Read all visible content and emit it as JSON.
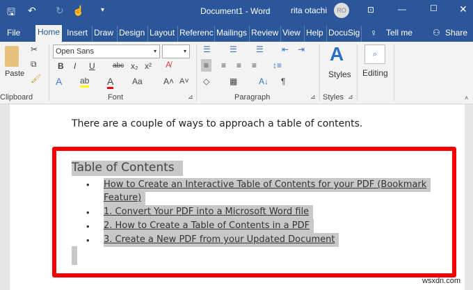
{
  "titlebar": {
    "title": "Document1  -  Word",
    "user": "rita otachi",
    "avatar": "RO"
  },
  "tabs": [
    "File",
    "Home",
    "Insert",
    "Draw",
    "Design",
    "Layout",
    "Referenc",
    "Mailings",
    "Review",
    "View",
    "Help",
    "DocuSig"
  ],
  "tell_me": "Tell me",
  "share": "Share",
  "ribbon": {
    "paste": "Paste",
    "font_name": "Open Sans",
    "font_size": "",
    "styles": "Styles",
    "editing": "Editing",
    "groups": {
      "clipboard": "Clipboard",
      "font": "Font",
      "paragraph": "Paragraph",
      "styles": "Styles"
    }
  },
  "document": {
    "intro": "There are a couple of ways to approach a table of contents.",
    "toc_title": "Table of Contents",
    "items": [
      "How to Create an Interactive Table of Contents for your PDF (Bookmark",
      "Feature)",
      "1. Convert Your PDF into a Microsoft Word file",
      "2. How to Create a Table of Contents in a PDF",
      "3. Create a New PDF from your Updated Document"
    ]
  },
  "watermark": "wsxdn.com",
  "colors": {
    "brand": "#2b579a",
    "highlight_box": "#f40000"
  }
}
